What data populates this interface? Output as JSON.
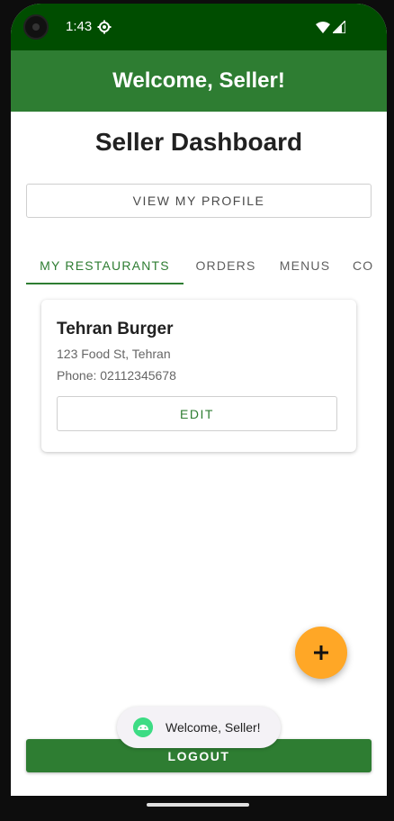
{
  "status_bar": {
    "time": "1:43",
    "icons": [
      "settings-icon",
      "wifi-icon",
      "signal-icon"
    ]
  },
  "app_bar": {
    "title": "Welcome, Seller!"
  },
  "main": {
    "title": "Seller Dashboard",
    "profile_button": "VIEW MY PROFILE",
    "tabs": [
      {
        "label": "MY RESTAURANTS",
        "active": true
      },
      {
        "label": "ORDERS",
        "active": false
      },
      {
        "label": "MENUS",
        "active": false
      },
      {
        "label": "CO",
        "active": false
      }
    ],
    "restaurants": [
      {
        "name": "Tehran Burger",
        "address": "123 Food St, Tehran",
        "phone": "Phone: 02112345678",
        "edit_label": "EDIT"
      }
    ],
    "fab_icon": "plus-icon",
    "logout_label": "LOGOUT"
  },
  "toast": {
    "icon": "android-icon",
    "message": "Welcome, Seller!"
  },
  "colors": {
    "status_bar": "#004d00",
    "primary": "#2e7d32",
    "fab": "#ffa726"
  }
}
